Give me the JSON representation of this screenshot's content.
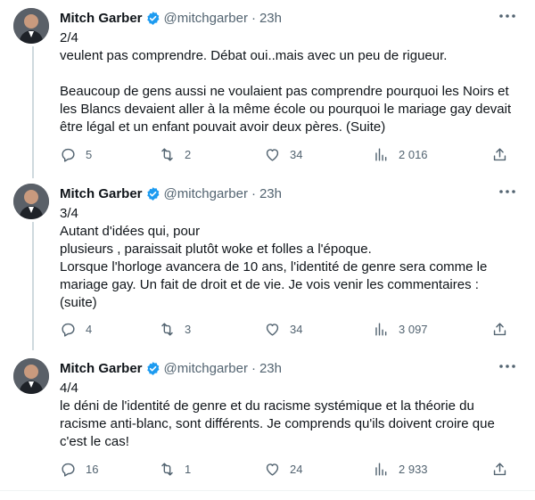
{
  "colors": {
    "text": "#0f1419",
    "muted": "#536471",
    "verified": "#1d9bf0",
    "border": "#eff3f4",
    "rail": "#cfd9de"
  },
  "tweets": [
    {
      "name": "Mitch Garber",
      "handle": "@mitchgarber",
      "dot": "·",
      "time": "23h",
      "text": "2/4\nveulent pas comprendre. Débat oui..mais avec un peu de rigueur.\n\nBeaucoup de gens aussi ne voulaient pas comprendre pourquoi les Noirs et les Blancs devaient aller à la même école ou pourquoi le mariage gay devait être légal et un enfant pouvait avoir deux pères. (Suite)",
      "replies": "5",
      "retweets": "2",
      "likes": "34",
      "views": "2 016"
    },
    {
      "name": "Mitch Garber",
      "handle": "@mitchgarber",
      "dot": "·",
      "time": "23h",
      "text": "3/4\nAutant d'idées qui, pour\nplusieurs , paraissait plutôt woke et folles a l'époque.\nLorsque l'horloge avancera de 10 ans, l'identité de genre sera comme le mariage gay. Un fait de droit et de vie. Je vois venir les commentaires : (suite)",
      "replies": "4",
      "retweets": "3",
      "likes": "34",
      "views": "3 097"
    },
    {
      "name": "Mitch Garber",
      "handle": "@mitchgarber",
      "dot": "·",
      "time": "23h",
      "text": "4/4\nle déni de l'identité de genre et du racisme systémique et la théorie du racisme anti-blanc, sont différents. Je comprends qu'ils doivent croire que c'est le cas!",
      "replies": "16",
      "retweets": "1",
      "likes": "24",
      "views": "2 933"
    }
  ]
}
